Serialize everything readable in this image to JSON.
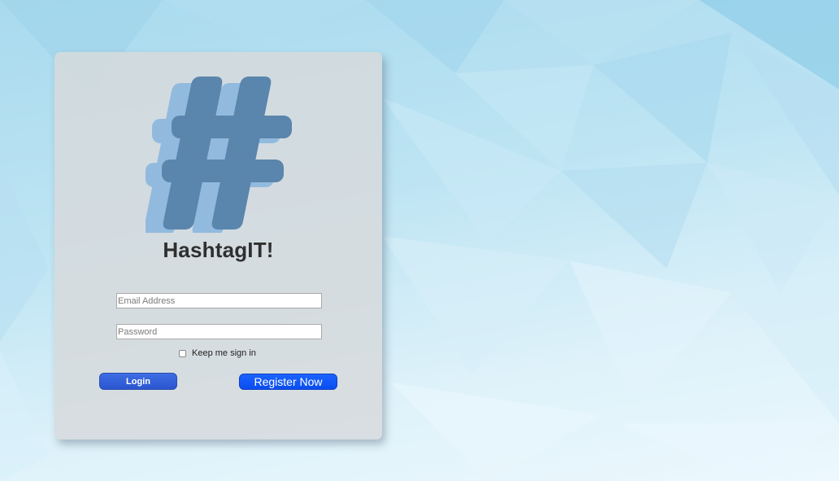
{
  "app": {
    "title": "HashtagIT!"
  },
  "login_form": {
    "email_placeholder": "Email Address",
    "password_placeholder": "Password",
    "remember_label": "Keep me sign in",
    "remember_checked": false,
    "login_label": "Login",
    "register_label": "Register Now"
  },
  "colors": {
    "logo_front": "#5a85ac",
    "logo_back": "#92bade",
    "login_button": "#2f5fd9",
    "register_button": "#0f55f5",
    "title_text": "#2f2f2f"
  },
  "icons": {
    "logo": "hashtag-icon"
  }
}
